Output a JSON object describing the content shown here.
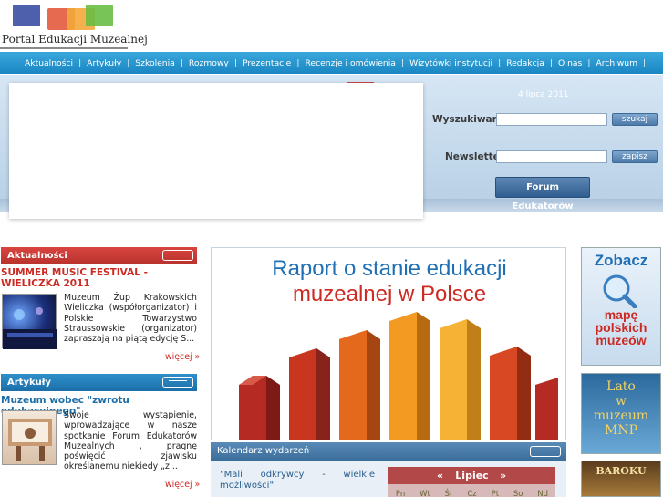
{
  "header": {
    "logo_text": "Portal Edukacji Muzealnej",
    "bubble_colors": [
      "#3b4fa3",
      "#e35a3c",
      "#f3a83b",
      "#6abe45"
    ]
  },
  "nav": {
    "items": [
      "Aktualności",
      "Artykuły",
      "Szkolenia",
      "Rozmowy",
      "Prezentacje",
      "Recenzje i omówienia",
      "Wizytówki instytucji",
      "Redakcja",
      "O nas",
      "Archiwum"
    ],
    "separator": "|"
  },
  "top": {
    "date": "4 lipca 2011",
    "search_label": "Wyszukiwanie:",
    "search_value": "",
    "search_button": "szukaj",
    "newsletter_label": "Newsletter:",
    "newsletter_value": "",
    "newsletter_button": "zapisz",
    "forum_button": "Forum Edukatorów"
  },
  "news": {
    "header": "Aktualności",
    "title": "SUMMER MUSIC FESTIVAL - WIELICZKA 2011",
    "text": "Muzeum Żup Krakowskich Wieliczka (współorganizator) i Polskie Towarzystwo Straussowskie (organizator) zapraszają na piątą edycję S...",
    "more": "więcej »"
  },
  "articles": {
    "header": "Artykuły",
    "title": "Muzeum wobec \"zwrotu edukacyjnego\"",
    "text": "Swoje wystąpienie, wprowadzające w nasze spotkanie Forum Edukatorów Muzealnych , pragnę poświęcić zjawisku określanemu niekiedy „z...",
    "more": "więcej »"
  },
  "report": {
    "line1": "Raport o stanie edukacji",
    "line2": "muzealnej w Polsce"
  },
  "calendar": {
    "header": "Kalendarz wydarzeń",
    "event": "\"Mali odkrywcy - wielkie możliwości\"",
    "month": "Lipiec",
    "prev": "«",
    "next": "»",
    "days": [
      "Pn",
      "Wt",
      "Śr",
      "Cz",
      "Pt",
      "So",
      "Nd"
    ]
  },
  "right": {
    "zobacz": "Zobacz",
    "map_line1": "mapę",
    "map_line2": "polskich",
    "map_line3": "muzeów",
    "promo2_line1": "Lato",
    "promo2_line2": "w",
    "promo2_line3": "muzeum",
    "promo2_line4": "MNP",
    "promo3": "BAROKU"
  },
  "colors": {
    "nav_blue": "#1f8bc9",
    "red_head": "#c63a34",
    "blue_head": "#2680bb",
    "cal_head": "#4a7daa",
    "month_bar": "#b24848"
  }
}
